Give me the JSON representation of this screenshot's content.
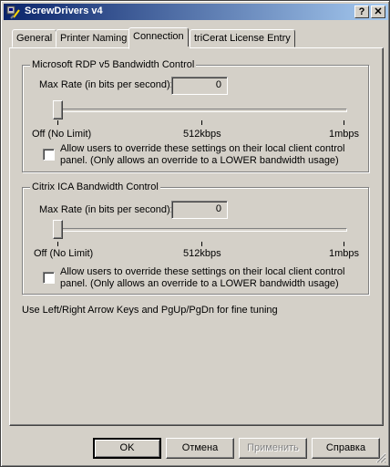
{
  "window": {
    "title": "ScrewDrivers v4",
    "help_label": "?",
    "close_label": "✕"
  },
  "tabs": [
    {
      "label": "General",
      "active": false
    },
    {
      "label": "Printer Naming",
      "active": false
    },
    {
      "label": "Connection",
      "active": true
    },
    {
      "label": "triCerat License Entry",
      "active": false
    }
  ],
  "rdp_group": {
    "title": "Microsoft RDP v5 Bandwidth Control",
    "rate_label": "Max Rate (in bits per second):",
    "rate_value": "0",
    "slider_level": 0,
    "tick_labels": [
      "Off (No Limit)",
      "512kbps",
      "1mbps"
    ],
    "override_text": "Allow users to override these settings on their local client control panel. (Only allows an override to a LOWER bandwidth usage)",
    "override_checked": false
  },
  "citrix_group": {
    "title": "Citrix ICA Bandwidth Control",
    "rate_label": "Max Rate (in bits per second):",
    "rate_value": "0",
    "slider_level": 0,
    "tick_labels": [
      "Off (No Limit)",
      "512kbps",
      "1mbps"
    ],
    "override_text": "Allow users to override these settings on their local client control panel. (Only allows an override to a LOWER bandwidth usage)",
    "override_checked": false
  },
  "hint_text": "Use Left/Right Arrow Keys and PgUp/PgDn for fine tuning",
  "buttons": {
    "ok": "OK",
    "cancel": "Отмена",
    "apply": "Применить",
    "help": "Справка"
  },
  "colors": {
    "face": "#d4d0c8",
    "title_start": "#0a246a",
    "title_end": "#a6caf0"
  }
}
